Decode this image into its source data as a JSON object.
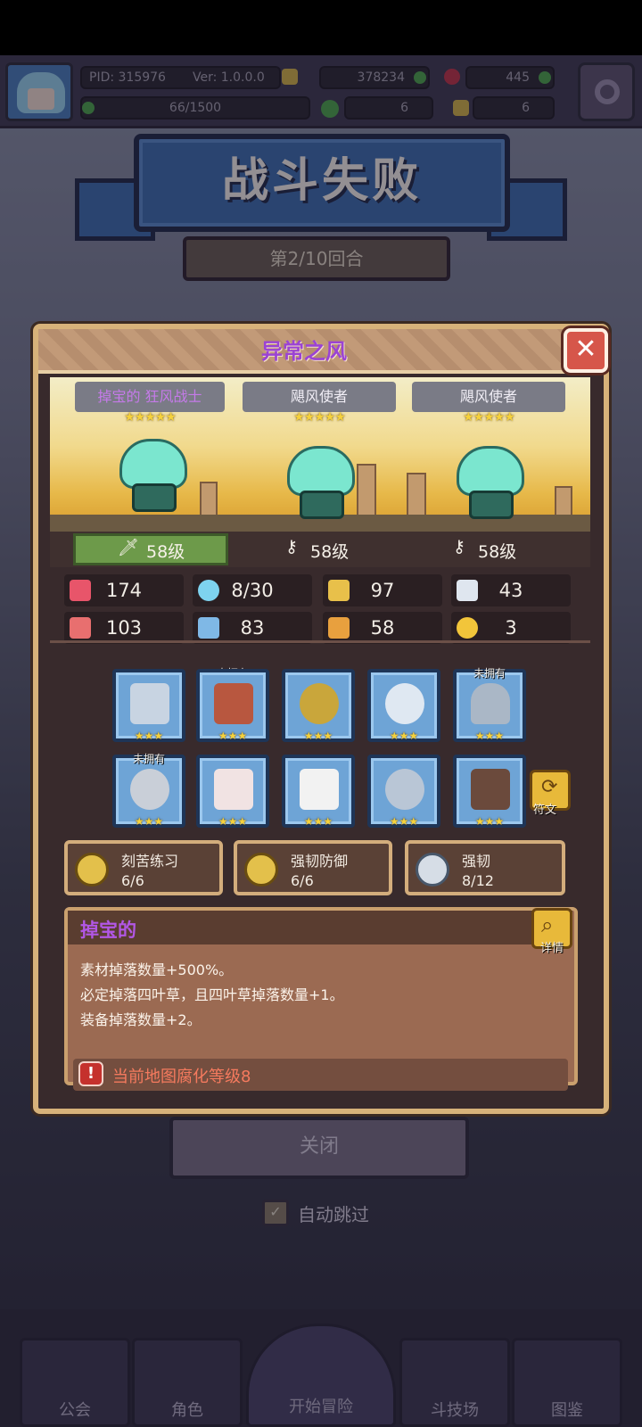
{
  "hud": {
    "pid": "PID: 315976",
    "ver": "Ver: 1.0.0.0",
    "gold": "378234",
    "gems": "445",
    "stamina": "66/1500",
    "clover_count": "6",
    "key_count": "6"
  },
  "battle": {
    "title": "战斗失败",
    "round": "第2/10回合",
    "close_label": "关闭",
    "auto_skip_label": "自动跳过"
  },
  "modal": {
    "title": "异常之风",
    "close_symbol": "✕",
    "units": [
      {
        "name": "掉宝的 狂风战士",
        "stars": "★★★★★",
        "level": "58级"
      },
      {
        "name": "飓风使者",
        "stars": "★★★★★",
        "level": "58级"
      },
      {
        "name": "飓风使者",
        "stars": "★★★★★",
        "level": "58级"
      }
    ],
    "stats": [
      {
        "icon": "heart-icon",
        "value": "174",
        "color": "#e8556a"
      },
      {
        "icon": "mana-drop-icon",
        "value": "8/30",
        "color": "#7ed3ef"
      },
      {
        "icon": "shield-icon",
        "value": "97",
        "color": "#e8c04a"
      },
      {
        "icon": "wing-icon",
        "value": "43",
        "color": "#dfe6ef"
      },
      {
        "icon": "fist-icon",
        "value": "103",
        "color": "#e86f6f"
      },
      {
        "icon": "book-icon",
        "value": "83",
        "color": "#7fb8e6"
      },
      {
        "icon": "scroll-icon",
        "value": "58",
        "color": "#e8a03e"
      },
      {
        "icon": "horseshoe-icon",
        "value": "3",
        "color": "#f2c53a"
      }
    ],
    "equipment": [
      {
        "name": "sword",
        "owned": true,
        "stars": "★★★",
        "color": "#c8d4e2"
      },
      {
        "name": "shield",
        "owned": false,
        "stars": "★★★",
        "color": "#b8573f"
      },
      {
        "name": "necklace",
        "owned": true,
        "stars": "★★★",
        "color": "#c9a63b"
      },
      {
        "name": "orb",
        "owned": true,
        "stars": "★★★",
        "color": "#dfe8f2"
      },
      {
        "name": "helmet",
        "owned": false,
        "stars": "★★★",
        "color": "#aab7c6"
      },
      {
        "name": "belt",
        "owned": false,
        "stars": "★★★",
        "color": "#c9cfd8"
      },
      {
        "name": "armor",
        "owned": true,
        "stars": "★★★",
        "color": "#f1e3e3"
      },
      {
        "name": "glove",
        "owned": true,
        "stars": "★★★",
        "color": "#f2f2f2"
      },
      {
        "name": "ring",
        "owned": true,
        "stars": "★★★",
        "color": "#b9c6d6"
      },
      {
        "name": "boots",
        "owned": true,
        "stars": "★★★",
        "color": "#6b4a3c"
      }
    ],
    "not_owned_label": "未拥有",
    "rune_label": "符文",
    "skills": [
      {
        "name": "刻苦练习",
        "progress": "6/6",
        "color": "#e3c04b"
      },
      {
        "name": "强韧防御",
        "progress": "6/6",
        "color": "#e3c04b"
      },
      {
        "name": "强韧",
        "progress": "8/12",
        "color": "#d6dde6"
      }
    ],
    "desc": {
      "title": "掉宝的",
      "detail_label": "详情",
      "lines": [
        "素材掉落数量+500%。",
        "必定掉落四叶草，且四叶草掉落数量+1。",
        "装备掉落数量+2。"
      ],
      "warning": "当前地图腐化等级8"
    }
  },
  "nav": [
    {
      "label": "公会"
    },
    {
      "label": "角色"
    },
    {
      "label": "开始冒险"
    },
    {
      "label": "斗技场"
    },
    {
      "label": "图鉴"
    }
  ]
}
